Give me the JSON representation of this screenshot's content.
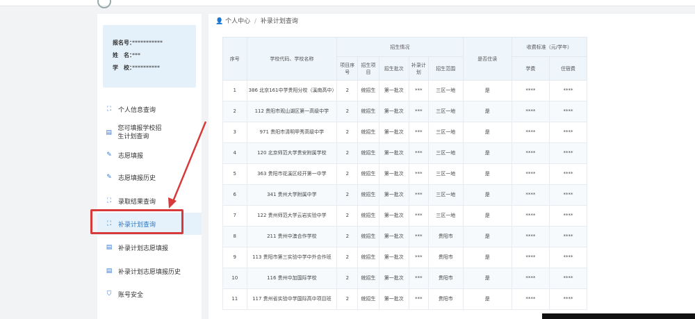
{
  "user": {
    "reg_label": "报名号：",
    "reg_value": "***********",
    "name_label": "姓　名：",
    "name_value": "***",
    "school_label": "学　校：",
    "school_value": "**********"
  },
  "menu": [
    {
      "label": "个人信息查询",
      "icon": "id-card-icon"
    },
    {
      "label": "您可填报学校招生计划查询",
      "icon": "document-icon"
    },
    {
      "label": "志愿填报",
      "icon": "pen-icon"
    },
    {
      "label": "志愿填报历史",
      "icon": "pen-icon"
    },
    {
      "label": "录取结果查询",
      "icon": "scan-icon"
    },
    {
      "label": "补录计划查询",
      "icon": "scan-icon",
      "active": true
    },
    {
      "label": "补录计划志愿填报",
      "icon": "form-icon"
    },
    {
      "label": "补录计划志愿填报历史",
      "icon": "form-icon"
    },
    {
      "label": "账号安全",
      "icon": "shield-icon"
    }
  ],
  "breadcrumb": {
    "home": "个人中心",
    "sep": "/",
    "current": "补录计划查询"
  },
  "table": {
    "headers": {
      "seq": "序号",
      "school": "学校代码、学校名称",
      "enroll_group": "招生情况",
      "item_seq": "项目序号",
      "item": "招生项目",
      "batch": "招生批次",
      "plan": "补录计划",
      "range": "招生范围",
      "boarding": "是否住读",
      "fee_group": "收费标准（元/学年）",
      "tuition": "学费",
      "board_fee": "住宿费"
    },
    "rows": [
      [
        "1",
        "386 北京161中学贵阳分校（溪南高中）",
        "2",
        "统招生",
        "第一批次",
        "***",
        "三区一地",
        "是",
        "****",
        "****"
      ],
      [
        "2",
        "112 贵阳市观山湖区第一高级中学",
        "2",
        "统招生",
        "第一批次",
        "***",
        "三区一地",
        "是",
        "****",
        "****"
      ],
      [
        "3",
        "971 贵阳市清明甲秀高级中学",
        "2",
        "统招生",
        "第一批次",
        "***",
        "三区一地",
        "是",
        "****",
        "****"
      ],
      [
        "4",
        "120 北京师范大学贵安附属学校",
        "2",
        "统招生",
        "第一批次",
        "***",
        "三区一地",
        "是",
        "****",
        "****"
      ],
      [
        "5",
        "363 贵阳市花溪区经开第一中学",
        "2",
        "统招生",
        "第一批次",
        "***",
        "三区一地",
        "是",
        "****",
        "****"
      ],
      [
        "6",
        "341 贵州大学附属中学",
        "2",
        "统招生",
        "第一批次",
        "***",
        "三区一地",
        "是",
        "****",
        "****"
      ],
      [
        "7",
        "122 贵州师范大学云岩实验中学",
        "2",
        "统招生",
        "第一批次",
        "***",
        "三区一地",
        "是",
        "****",
        "****"
      ],
      [
        "8",
        "211 贵州中澳合作学校",
        "2",
        "统招生",
        "第一批次",
        "***",
        "贵阳市",
        "是",
        "****",
        "****"
      ],
      [
        "9",
        "113 贵阳市第三实验中学中外合作班",
        "2",
        "统招生",
        "第一批次",
        "***",
        "贵阳市",
        "是",
        "****",
        "****"
      ],
      [
        "10",
        "116 贵州中加国际学校",
        "2",
        "统招生",
        "第一批次",
        "***",
        "贵阳市",
        "是",
        "****",
        "****"
      ],
      [
        "11",
        "117 贵州省实验中学国际高中项目班",
        "2",
        "统招生",
        "第一批次",
        "***",
        "贵阳市",
        "是",
        "****",
        "****"
      ]
    ]
  }
}
